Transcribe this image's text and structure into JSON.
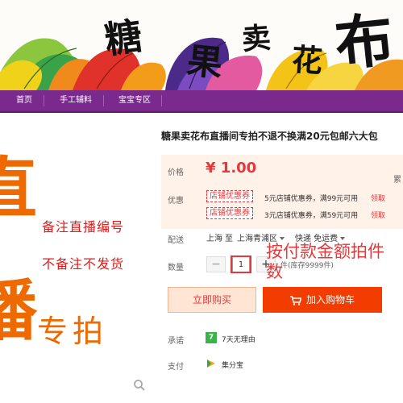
{
  "banner": {
    "chars": [
      "糖",
      "果",
      "卖",
      "花",
      "布"
    ]
  },
  "nav": {
    "items": [
      "首页",
      "手工辅料",
      "宝宝专区"
    ]
  },
  "promo": {
    "big_chars": [
      "直",
      "播"
    ],
    "line1": "备注直播编号",
    "line2": "不备注不发货",
    "zhuanpai": "专拍"
  },
  "product": {
    "title": "糖果卖花布直播间专拍不退不换满20元包邮六大包",
    "price_label": "价格",
    "price": "¥ 1.00",
    "price_side": "累",
    "coupon_label": "优惠",
    "coupons": [
      {
        "tag": "店铺优惠券",
        "text": "5元店铺优惠券，满99元可用",
        "get": "领取"
      },
      {
        "tag": "店铺优惠券",
        "text": "3元店铺优惠券，满59元可用",
        "get": "领取"
      }
    ],
    "ship_label": "配送",
    "ship_from": "上海",
    "ship_to_word": "至",
    "ship_to": "上海青浦区",
    "ship_method": "快递 免运费",
    "qty_label": "数量",
    "qty_minus": "−",
    "qty_value": "1",
    "qty_plus": "+",
    "stock": "件(库存9999件)",
    "note": "按付款金额拍件数",
    "buy_now": "立即购买",
    "add_cart": "加入购物车",
    "promise_label": "承诺",
    "promise_badge": "7",
    "promise": "7天无理由",
    "pay_label": "支付",
    "pay": "集分宝"
  },
  "colors": {
    "accent": "#e4393c",
    "nav": "#7a2a8c",
    "orange": "#ee6a00",
    "cart": "#f23c00"
  }
}
